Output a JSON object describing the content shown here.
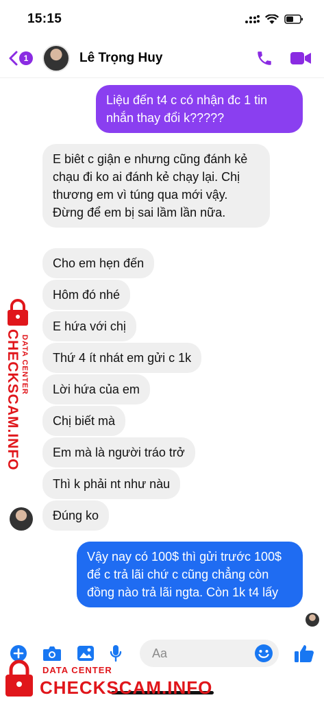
{
  "status_bar": {
    "time": "15:15"
  },
  "header": {
    "unread_count": "1",
    "contact_name": "Lê Trọng Huy"
  },
  "messages": [
    {
      "text": "Liệu đến t4 c có nhận đc 1 tin nhắn thay đổi k?????",
      "direction": "outgoing",
      "color": "#8a3ff0"
    },
    {
      "text": "E biêt c giận e nhưng cũng đánh kẻ chạu đi ko ai đánh kẻ chạy lại. Chị thương em vì túng qua mới vậy. Đừng để em bị sai lầm lần nữa.",
      "direction": "incoming"
    },
    {
      "text": "Cho em hẹn đến",
      "direction": "incoming"
    },
    {
      "text": "Hôm đó nhé",
      "direction": "incoming"
    },
    {
      "text": "E hứa với chị",
      "direction": "incoming"
    },
    {
      "text": "Thứ 4 ít nhát em gửi c 1k",
      "direction": "incoming"
    },
    {
      "text": "Lời hứa của em",
      "direction": "incoming"
    },
    {
      "text": "Chị biết mà",
      "direction": "incoming"
    },
    {
      "text": "Em mà là người tráo trở",
      "direction": "incoming"
    },
    {
      "text": "Thì k phải nt như nàu",
      "direction": "incoming"
    },
    {
      "text": "Đúng ko",
      "direction": "incoming"
    },
    {
      "text": "Vậy nay có 100$ thì gửi trước 100$ để c trả lãi chứ c cũng chẳng còn đồng nào trả lãi ngta. Còn 1k t4 lấy",
      "direction": "outgoing",
      "color": "#1f6cf2"
    }
  ],
  "composer": {
    "placeholder": "Aa"
  },
  "watermark": {
    "site": "CHECKSCAM.INFO",
    "label": "DATA CENTER"
  },
  "colors": {
    "accent": "#8a2be2",
    "incoming_bubble": "#efefef",
    "like": "#1877f2",
    "watermark": "#e0161b"
  }
}
